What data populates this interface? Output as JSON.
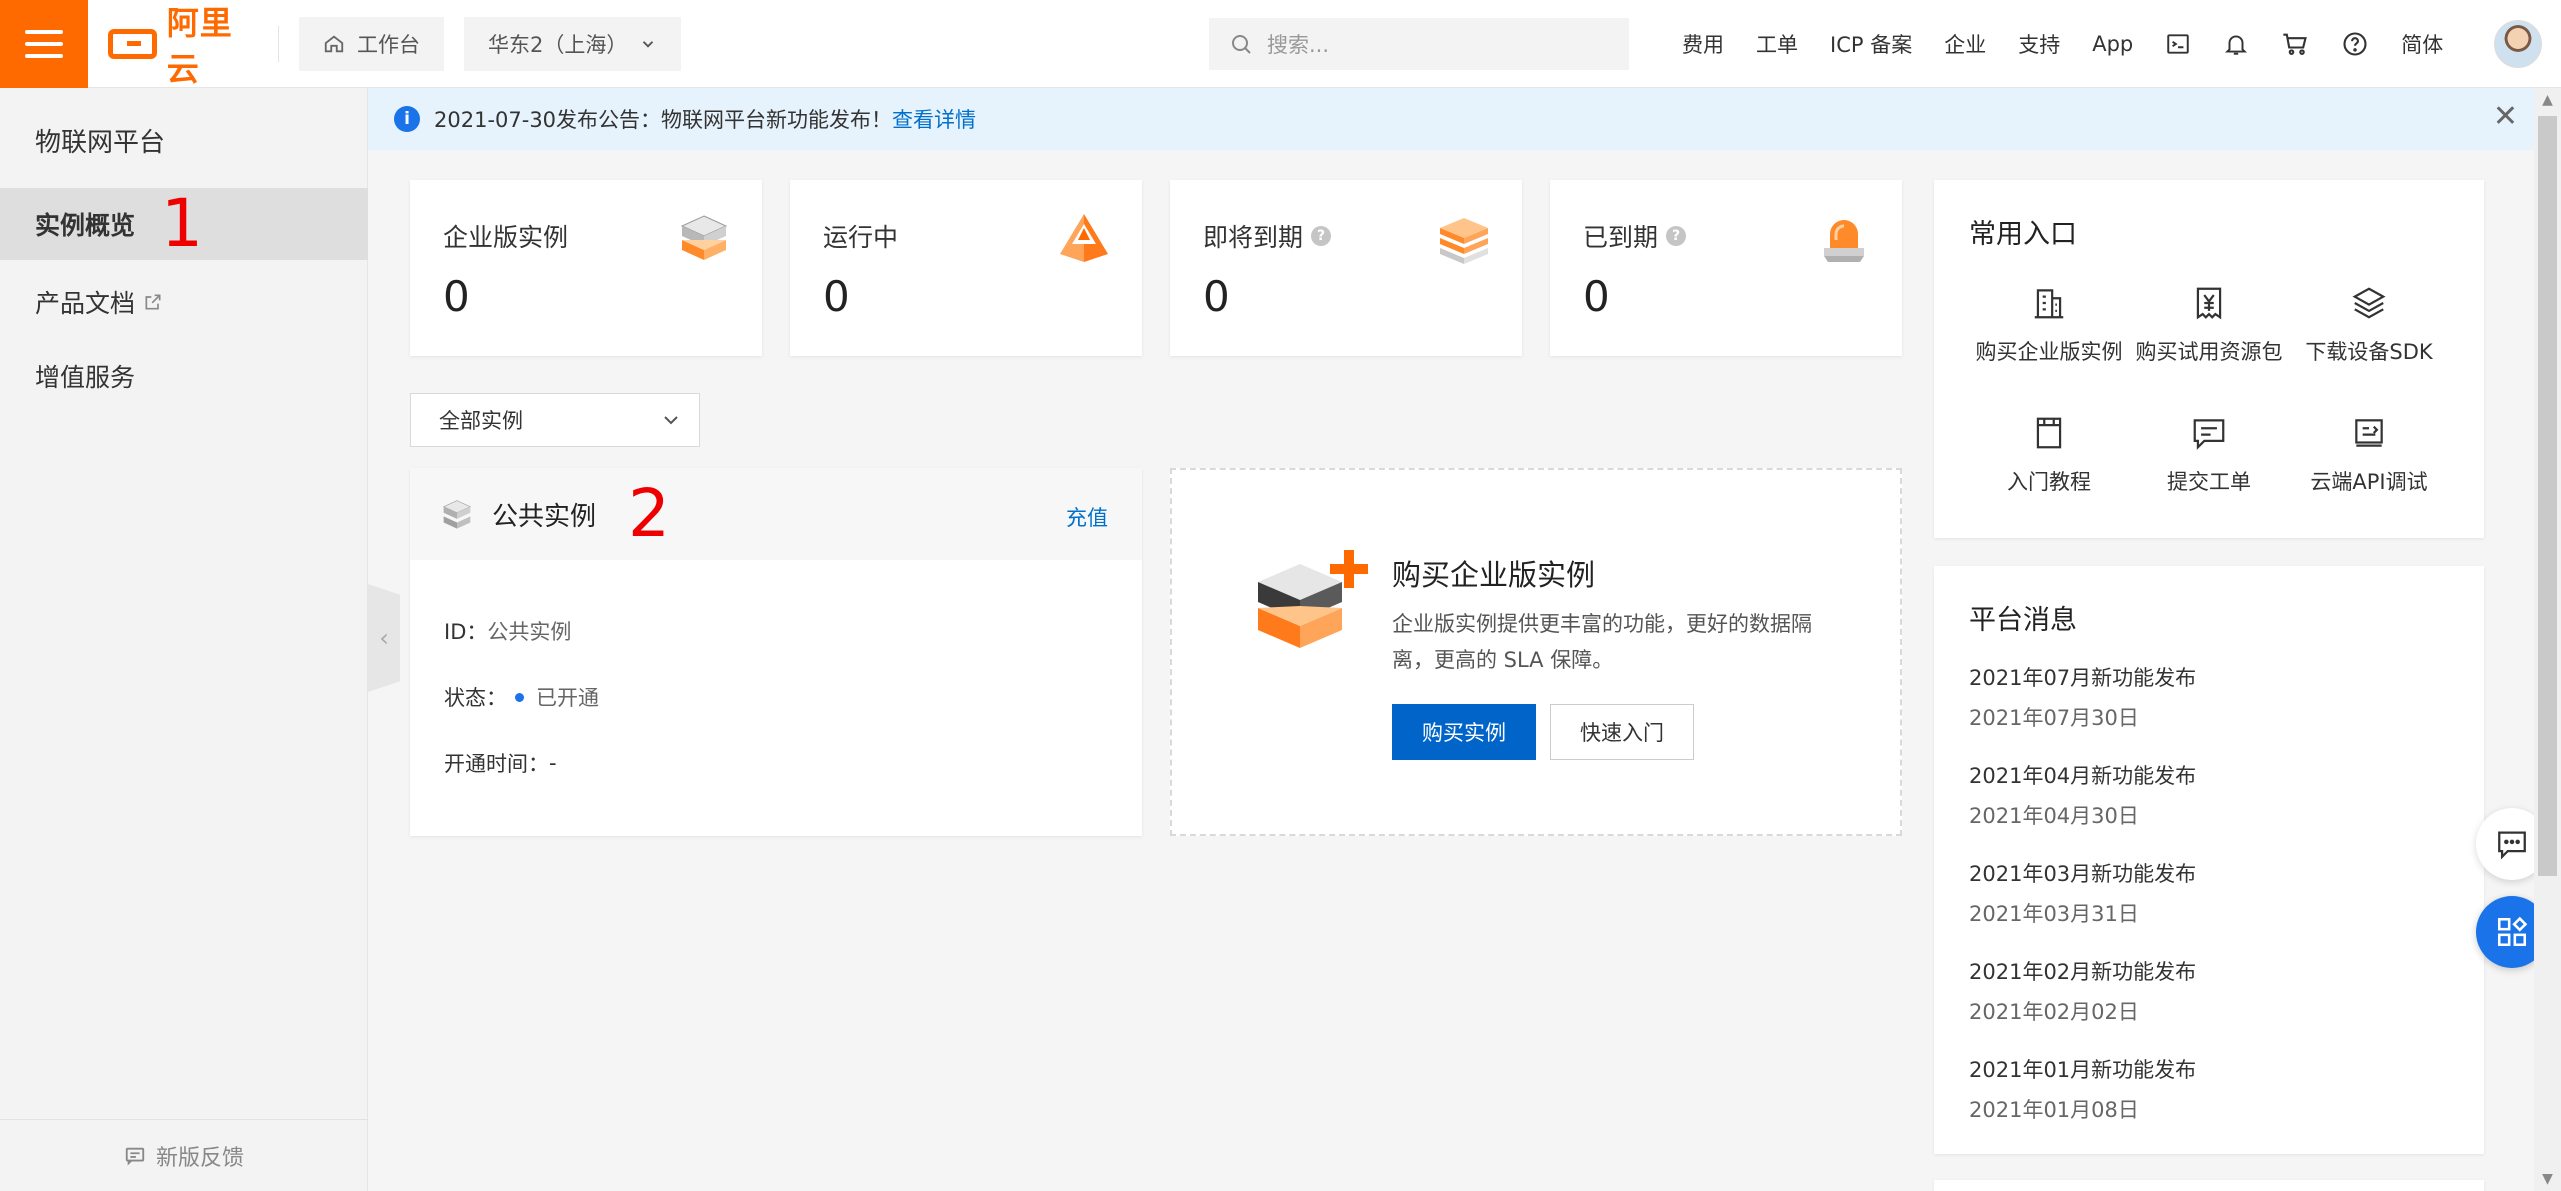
{
  "topbar": {
    "logo_text": "阿里云",
    "workbench": "工作台",
    "region": "华东2（上海）",
    "search_placeholder": "搜索...",
    "nav": [
      "费用",
      "工单",
      "ICP 备案",
      "企业",
      "支持",
      "App"
    ],
    "lang": "简体"
  },
  "sidebar": {
    "title": "物联网平台",
    "items": [
      {
        "label": "实例概览",
        "annotation": "1"
      },
      {
        "label": "产品文档"
      },
      {
        "label": "增值服务"
      }
    ],
    "feedback": "新版反馈"
  },
  "notice": {
    "text": "2021-07-30发布公告：物联网平台新功能发布！",
    "link": "查看详情"
  },
  "stats": [
    {
      "label": "企业版实例",
      "value": "0",
      "help": false
    },
    {
      "label": "运行中",
      "value": "0",
      "help": false
    },
    {
      "label": "即将到期",
      "value": "0",
      "help": true
    },
    {
      "label": "已到期",
      "value": "0",
      "help": true
    }
  ],
  "filter": {
    "selected": "全部实例"
  },
  "public_instance": {
    "title": "公共实例",
    "annotation": "2",
    "recharge": "充值",
    "id_label": "ID：",
    "id_value": "公共实例",
    "status_label": "状态：",
    "status_value": "已开通",
    "opened_label": "开通时间：",
    "opened_value": "-"
  },
  "buy": {
    "title": "购买企业版实例",
    "desc": "企业版实例提供更丰富的功能，更好的数据隔离，更高的 SLA 保障。",
    "primary": "购买实例",
    "secondary": "快速入门"
  },
  "quick": {
    "title": "常用入口",
    "items": [
      {
        "label": "购买企业版实例",
        "icon": "building-icon"
      },
      {
        "label": "购买试用资源包",
        "icon": "yen-receipt-icon"
      },
      {
        "label": "下载设备SDK",
        "icon": "layers-icon"
      },
      {
        "label": "入门教程",
        "icon": "book-icon"
      },
      {
        "label": "提交工单",
        "icon": "chat-ticket-icon"
      },
      {
        "label": "云端API调试",
        "icon": "api-debug-icon"
      }
    ]
  },
  "messages": {
    "title": "平台消息",
    "items": [
      {
        "title": "2021年07月新功能发布",
        "date": "2021年07月30日"
      },
      {
        "title": "2021年04月新功能发布",
        "date": "2021年04月30日"
      },
      {
        "title": "2021年03月新功能发布",
        "date": "2021年03月31日"
      },
      {
        "title": "2021年02月新功能发布",
        "date": "2021年02月02日"
      },
      {
        "title": "2021年01月新功能发布",
        "date": "2021年01月08日"
      }
    ]
  },
  "colors": {
    "brand": "#ff6a00",
    "primary": "#0064c8",
    "link": "#0070cc",
    "annotation": "#ee0000"
  }
}
